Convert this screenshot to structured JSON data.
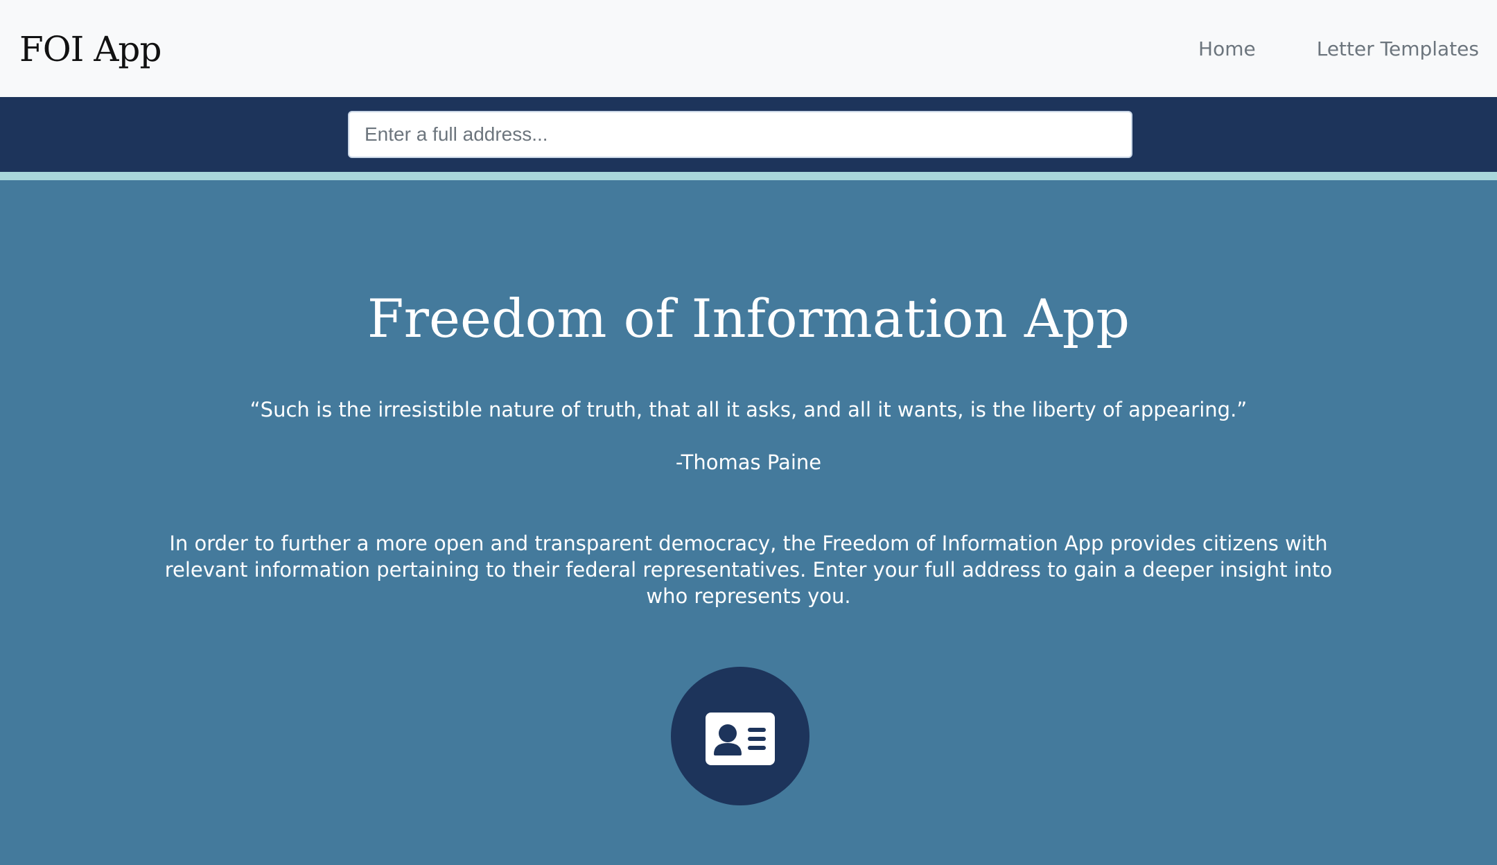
{
  "navbar": {
    "brand": "FOI App",
    "links": [
      "Home",
      "Letter Templates"
    ]
  },
  "search": {
    "placeholder": "Enter a full address...",
    "value": ""
  },
  "hero": {
    "title": "Freedom of Information App",
    "quote": "“Such is the irresistible nature of truth, that all it asks, and all it wants, is the liberty of appearing.”",
    "author": "-Thomas Paine",
    "description": "In order to further a more open and transparent democracy, the Freedom of Information App provides citizens with relevant information pertaining to their federal representatives. Enter your full address to gain a deeper insight into who represents you."
  },
  "icons": {
    "contact": "id-card-icon"
  },
  "colors": {
    "navbar_bg": "#f8f9fa",
    "searchbar_bg": "#1d345b",
    "accent_rule": "#a9d6db",
    "hero_bg": "#447a9c",
    "circle_bg": "#1d345b",
    "text_light": "#ffffff",
    "nav_link": "#6c757d"
  }
}
